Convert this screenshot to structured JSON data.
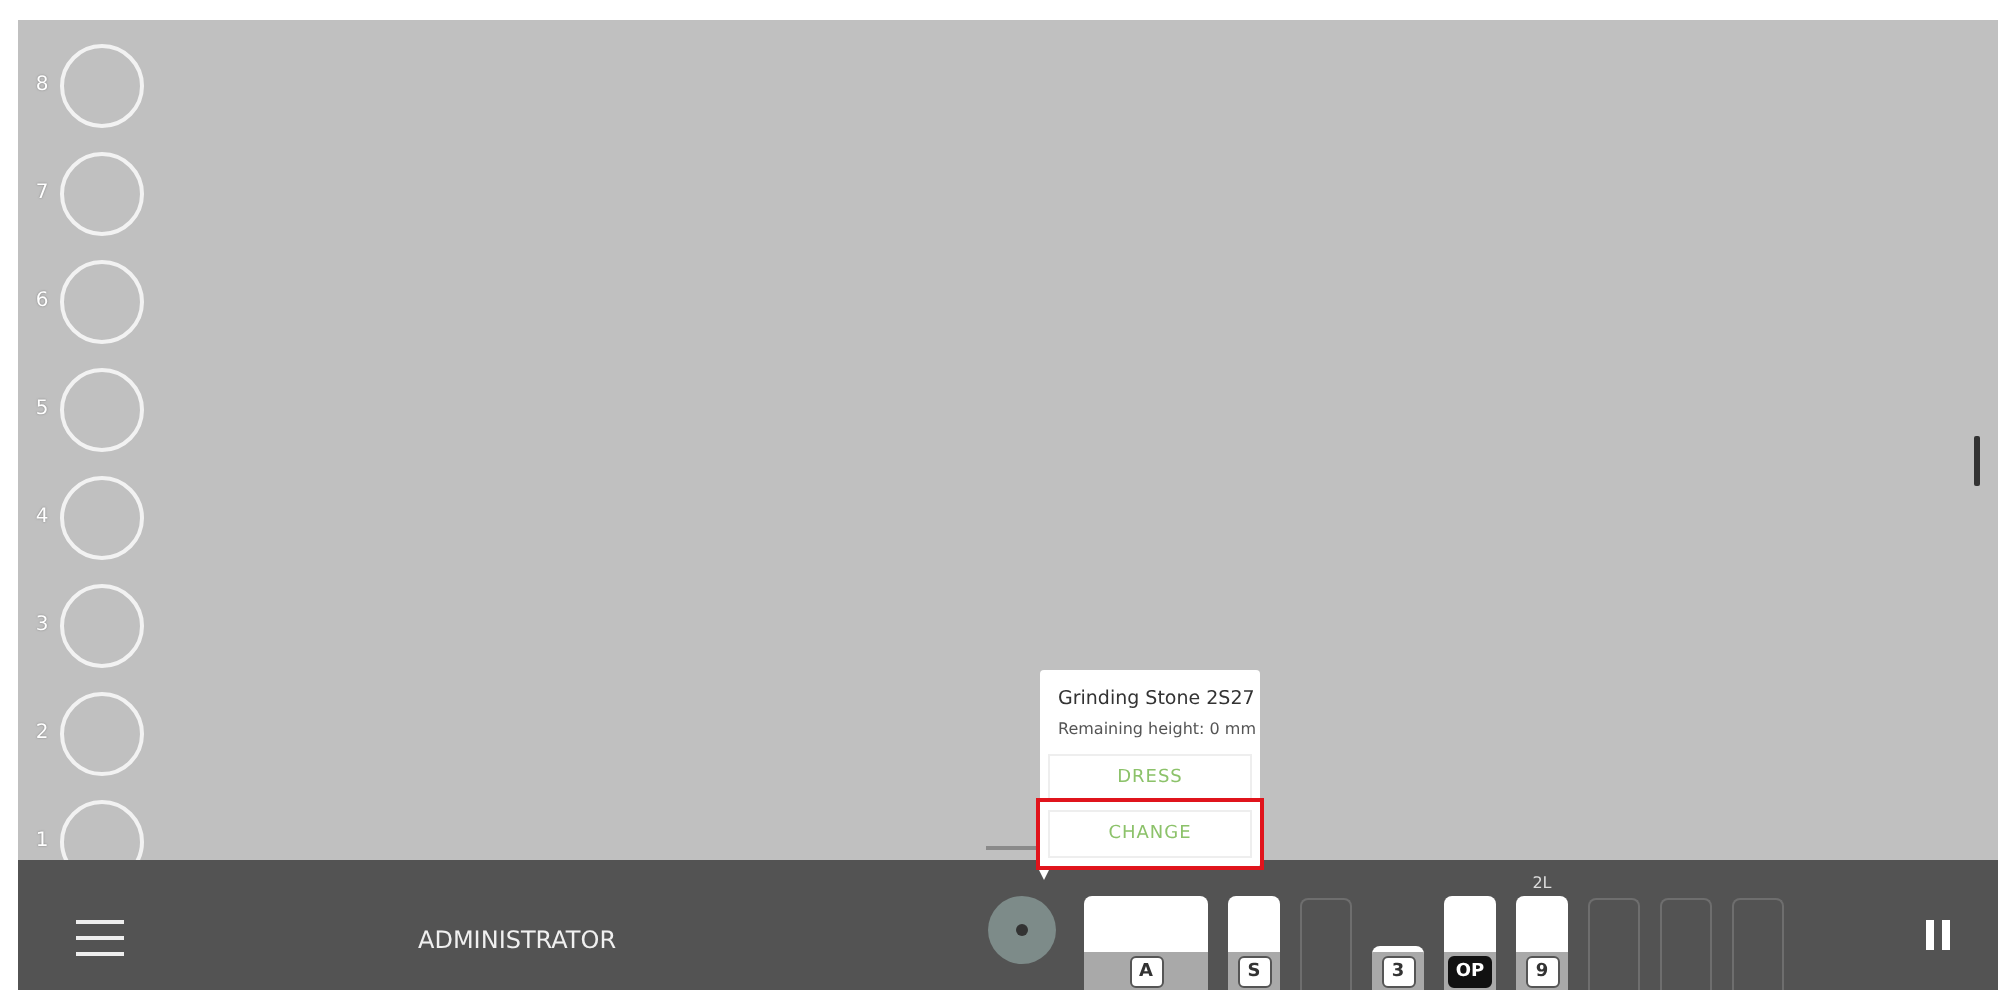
{
  "positions": [
    {
      "label": "8"
    },
    {
      "label": "7"
    },
    {
      "label": "6"
    },
    {
      "label": "5"
    },
    {
      "label": "4"
    },
    {
      "label": "3"
    },
    {
      "label": "2"
    },
    {
      "label": "1"
    }
  ],
  "popup": {
    "title": "Grinding Stone 2S27",
    "subtitle": "Remaining height: 0 mm",
    "actions": [
      {
        "label": "DRESS",
        "highlighted": false
      },
      {
        "label": "CHANGE",
        "highlighted": true
      }
    ]
  },
  "bottom_bar": {
    "user": "ADMINISTRATOR",
    "magazines": [
      {
        "kind": "tool",
        "badge": "A",
        "inverted": false,
        "lowered": false,
        "wide": true
      },
      {
        "kind": "tool",
        "badge": "S",
        "inverted": false,
        "lowered": false,
        "wide": false
      },
      {
        "kind": "empty"
      },
      {
        "kind": "tool",
        "badge": "3",
        "inverted": false,
        "lowered": true,
        "wide": false
      },
      {
        "kind": "tool",
        "badge": "OP",
        "inverted": true,
        "lowered": false,
        "wide": false
      },
      {
        "kind": "tool",
        "badge": "9",
        "inverted": false,
        "lowered": false,
        "wide": false,
        "top_label": "2L"
      },
      {
        "kind": "empty"
      },
      {
        "kind": "empty"
      },
      {
        "kind": "empty"
      }
    ]
  }
}
